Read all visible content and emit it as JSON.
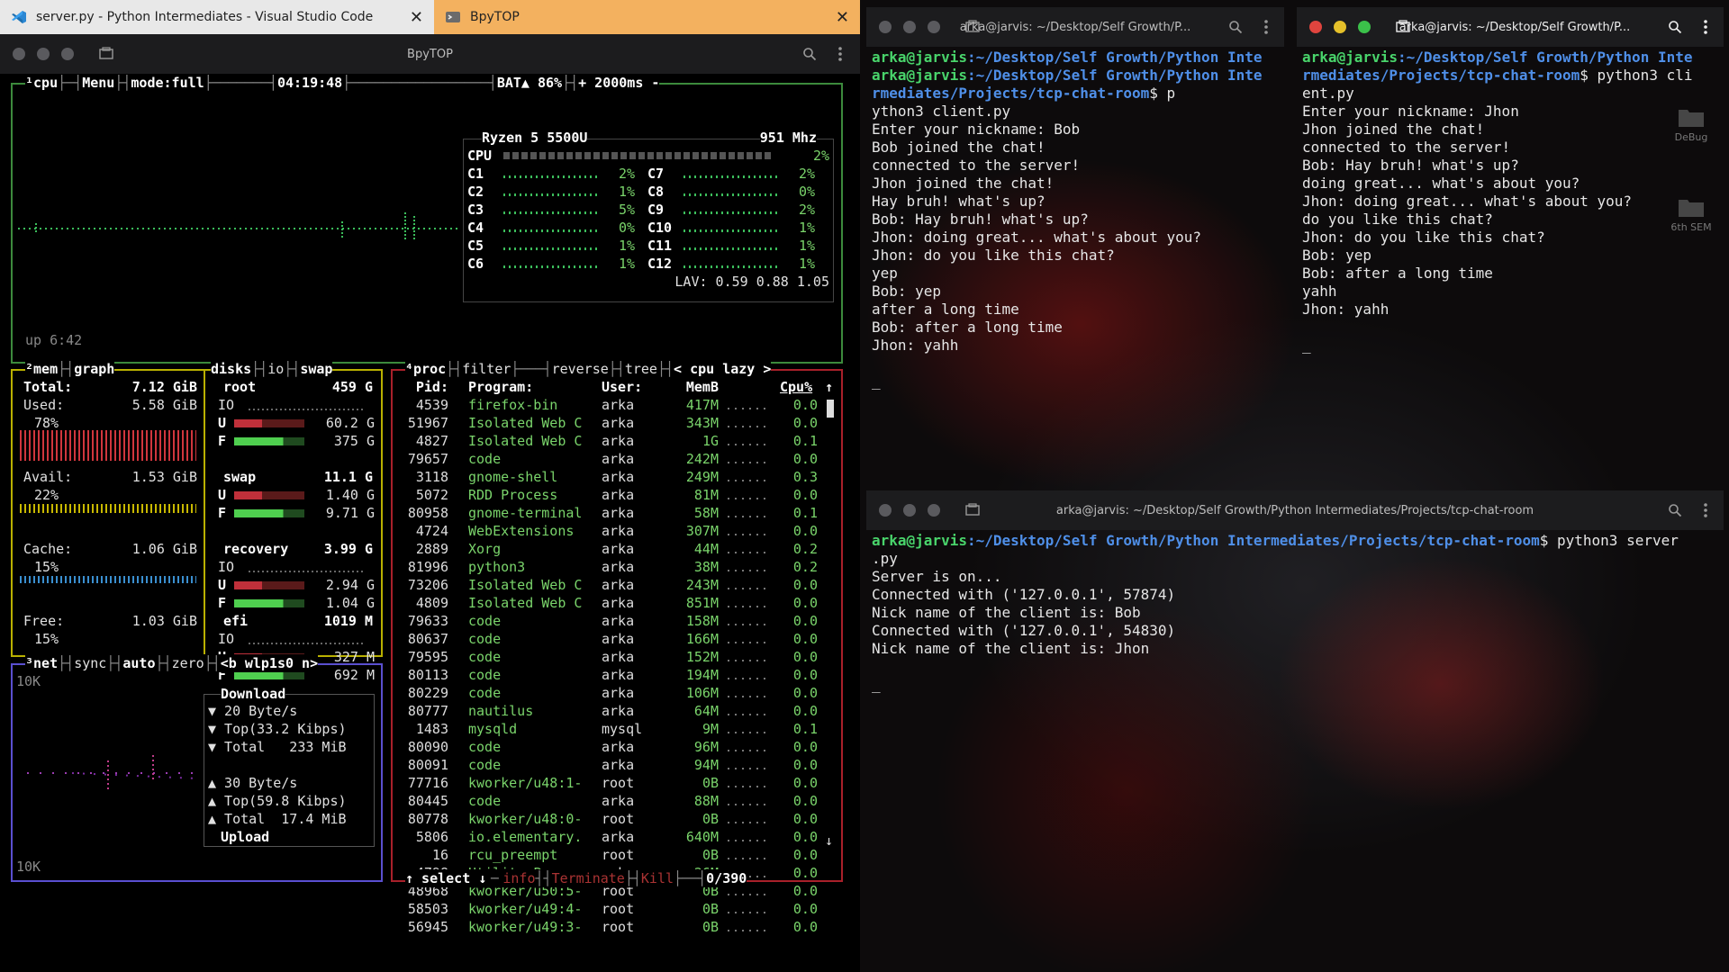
{
  "tabs": [
    {
      "label": "server.py - Python Intermediates - Visual Studio Code",
      "close": "✕"
    },
    {
      "label": "BpyTOP",
      "close": "✕"
    }
  ],
  "btop": {
    "window_title": "BpyTOP",
    "cpu_header": {
      "cpu": "¹cpu",
      "menu": "Menu",
      "mode": "mode:full",
      "clock": "04:19:48",
      "battery": "BAT▲ 86%",
      "update": "+ 2000ms -"
    },
    "cpu_model": "Ryzen 5 5500U",
    "cpu_freq": "951 Mhz",
    "cpu_total": {
      "label": "CPU",
      "pct": "2%"
    },
    "cores_left": [
      {
        "label": "C1",
        "pct": "2%"
      },
      {
        "label": "C2",
        "pct": "1%"
      },
      {
        "label": "C3",
        "pct": "5%"
      },
      {
        "label": "C4",
        "pct": "0%"
      },
      {
        "label": "C5",
        "pct": "1%"
      },
      {
        "label": "C6",
        "pct": "1%"
      }
    ],
    "cores_right": [
      {
        "label": "C7",
        "pct": "2%"
      },
      {
        "label": "C8",
        "pct": "0%"
      },
      {
        "label": "C9",
        "pct": "2%"
      },
      {
        "label": "C10",
        "pct": "1%"
      },
      {
        "label": "C11",
        "pct": "1%"
      },
      {
        "label": "C12",
        "pct": "1%"
      }
    ],
    "lav": "LAV: 0.59 0.88 1.05",
    "uptime": "up 6:42",
    "mem": {
      "header": {
        "mem": "²mem",
        "graph": "graph"
      },
      "total_label": "Total:",
      "total": "7.12 GiB",
      "used_label": "Used:",
      "used": "5.58 GiB",
      "used_pct": "78%",
      "avail_label": "Avail:",
      "avail": "1.53 GiB",
      "avail_pct": "22%",
      "cache_label": "Cache:",
      "cache": "1.06 GiB",
      "cache_pct": "15%",
      "free_label": "Free:",
      "free": "1.03 GiB",
      "free_pct": "15%"
    },
    "disks": {
      "header": {
        "disks": "disks",
        "io": "io",
        "swap": "swap"
      },
      "items": [
        {
          "name": "root",
          "size": "459 G",
          "io": "IO",
          "u": "60.2 G",
          "f": "375 G"
        },
        {
          "name": "swap",
          "size": "11.1 G",
          "u": "1.40 G",
          "f": "9.71 G"
        },
        {
          "name": "recovery",
          "size": "3.99 G",
          "io": "IO",
          "u": "2.94 G",
          "f": "1.04 G"
        },
        {
          "name": "efi",
          "size": "1019 M",
          "io": "IO",
          "u": "327 M",
          "f": "692 M"
        }
      ]
    },
    "net": {
      "header": {
        "net": "³net",
        "sync": "sync",
        "auto": "auto",
        "zero": "zero",
        "iface": "<b wlp1s0 n>"
      },
      "scale_top": "10K",
      "scale_bottom": "10K",
      "download_title": "Download",
      "down_rate": "▼ 20 Byte/s",
      "down_top": "▼ Top(33.2 Kibps)",
      "down_total": "▼ Total   233 MiB",
      "up_rate": "▲ 30 Byte/s",
      "up_top": "▲ Top(59.8 Kibps)",
      "up_total": "▲ Total  17.4 MiB",
      "upload_title": "Upload"
    },
    "proc": {
      "header": {
        "proc": "⁴proc",
        "filter": "filter",
        "reverse": "reverse",
        "tree": "tree",
        "sort": "< cpu lazy >"
      },
      "columns": {
        "pid": "Pid:",
        "program": "Program:",
        "user": "User:",
        "mem": "MemB",
        "cpu": "Cpu%"
      },
      "rows": [
        {
          "pid": "4539",
          "program": "firefox-bin",
          "user": "arka",
          "mem": "417M",
          "cpu": "0.0"
        },
        {
          "pid": "51967",
          "program": "Isolated Web C",
          "user": "arka",
          "mem": "343M",
          "cpu": "0.0"
        },
        {
          "pid": "4827",
          "program": "Isolated Web C",
          "user": "arka",
          "mem": "1G",
          "cpu": "0.1"
        },
        {
          "pid": "79657",
          "program": "code",
          "user": "arka",
          "mem": "242M",
          "cpu": "0.0"
        },
        {
          "pid": "3118",
          "program": "gnome-shell",
          "user": "arka",
          "mem": "249M",
          "cpu": "0.3"
        },
        {
          "pid": "5072",
          "program": "RDD Process",
          "user": "arka",
          "mem": "81M",
          "cpu": "0.0"
        },
        {
          "pid": "80958",
          "program": "gnome-terminal",
          "user": "arka",
          "mem": "58M",
          "cpu": "0.1"
        },
        {
          "pid": "4724",
          "program": "WebExtensions",
          "user": "arka",
          "mem": "307M",
          "cpu": "0.0"
        },
        {
          "pid": "2889",
          "program": "Xorg",
          "user": "arka",
          "mem": "44M",
          "cpu": "0.2"
        },
        {
          "pid": "81996",
          "program": "python3",
          "user": "arka",
          "mem": "38M",
          "cpu": "0.2"
        },
        {
          "pid": "73206",
          "program": "Isolated Web C",
          "user": "arka",
          "mem": "243M",
          "cpu": "0.0"
        },
        {
          "pid": "4809",
          "program": "Isolated Web C",
          "user": "arka",
          "mem": "851M",
          "cpu": "0.0"
        },
        {
          "pid": "79633",
          "program": "code",
          "user": "arka",
          "mem": "158M",
          "cpu": "0.0"
        },
        {
          "pid": "80637",
          "program": "code",
          "user": "arka",
          "mem": "166M",
          "cpu": "0.0"
        },
        {
          "pid": "79595",
          "program": "code",
          "user": "arka",
          "mem": "152M",
          "cpu": "0.0"
        },
        {
          "pid": "80113",
          "program": "code",
          "user": "arka",
          "mem": "194M",
          "cpu": "0.0"
        },
        {
          "pid": "80229",
          "program": "code",
          "user": "arka",
          "mem": "106M",
          "cpu": "0.0"
        },
        {
          "pid": "80777",
          "program": "nautilus",
          "user": "arka",
          "mem": "64M",
          "cpu": "0.0"
        },
        {
          "pid": "1483",
          "program": "mysqld",
          "user": "mysql",
          "mem": "9M",
          "cpu": "0.1"
        },
        {
          "pid": "80090",
          "program": "code",
          "user": "arka",
          "mem": "96M",
          "cpu": "0.0"
        },
        {
          "pid": "80091",
          "program": "code",
          "user": "arka",
          "mem": "94M",
          "cpu": "0.0"
        },
        {
          "pid": "77716",
          "program": "kworker/u48:1-",
          "user": "root",
          "mem": "0B",
          "cpu": "0.0"
        },
        {
          "pid": "80445",
          "program": "code",
          "user": "arka",
          "mem": "88M",
          "cpu": "0.0"
        },
        {
          "pid": "80778",
          "program": "kworker/u48:0-",
          "user": "root",
          "mem": "0B",
          "cpu": "0.0"
        },
        {
          "pid": "5806",
          "program": "io.elementary.",
          "user": "arka",
          "mem": "640M",
          "cpu": "0.0"
        },
        {
          "pid": "16",
          "program": "rcu_preempt",
          "user": "root",
          "mem": "0B",
          "cpu": "0.0"
        },
        {
          "pid": "4798",
          "program": "Utility Proces",
          "user": "arka",
          "mem": "26M",
          "cpu": "0.0"
        },
        {
          "pid": "48968",
          "program": "kworker/u50:5-",
          "user": "root",
          "mem": "0B",
          "cpu": "0.0"
        },
        {
          "pid": "58503",
          "program": "kworker/u49:4-",
          "user": "root",
          "mem": "0B",
          "cpu": "0.0"
        },
        {
          "pid": "56945",
          "program": "kworker/u49:3-",
          "user": "root",
          "mem": "0B",
          "cpu": "0.0"
        }
      ],
      "footer": {
        "select": "↑ select ↓",
        "info": "info",
        "terminate": "Terminate",
        "kill": "Kill",
        "count": "0/390"
      }
    }
  },
  "term_client1": {
    "title": "arka@jarvis: ~/Desktop/Self Growth/P...",
    "lines": [
      {
        "user": "arka@jarvis",
        "path": ":~/Desktop/Self Growth/Python Inte",
        "rest": ""
      },
      {
        "user": "arka@jarvis",
        "path": ":~/Desktop/Self Growth/Python Inte",
        "rest": ""
      },
      {
        "user": "",
        "path": "rmediates/Projects/tcp-chat-room",
        "rest": "$ p"
      },
      {
        "user": "",
        "path": "",
        "rest": "ython3 client.py"
      },
      {
        "user": "",
        "path": "",
        "rest": "Enter your nickname: Bob"
      },
      {
        "user": "",
        "path": "",
        "rest": "Bob joined the chat!"
      },
      {
        "user": "",
        "path": "",
        "rest": "connected to the server!"
      },
      {
        "user": "",
        "path": "",
        "rest": "Jhon joined the chat!"
      },
      {
        "user": "",
        "path": "",
        "rest": "Hay bruh! what's up?"
      },
      {
        "user": "",
        "path": "",
        "rest": "Bob: Hay bruh! what's up?"
      },
      {
        "user": "",
        "path": "",
        "rest": "Jhon: doing great... what's about you?"
      },
      {
        "user": "",
        "path": "",
        "rest": "Jhon: do you like this chat?"
      },
      {
        "user": "",
        "path": "",
        "rest": "yep"
      },
      {
        "user": "",
        "path": "",
        "rest": "Bob: yep"
      },
      {
        "user": "",
        "path": "",
        "rest": "after a long time"
      },
      {
        "user": "",
        "path": "",
        "rest": "Bob: after a long time"
      },
      {
        "user": "",
        "path": "",
        "rest": "Jhon: yahh"
      },
      {
        "user": "",
        "path": "",
        "rest": ""
      },
      {
        "user": "",
        "path": "",
        "rest": "_"
      }
    ]
  },
  "term_client2": {
    "title": "arka@jarvis: ~/Desktop/Self Growth/P...",
    "lines": [
      {
        "user": "arka@jarvis",
        "path": ":~/Desktop/Self Growth/Python Inte",
        "rest": ""
      },
      {
        "user": "",
        "path": "rmediates/Projects/tcp-chat-room",
        "rest": "$ python3 cli"
      },
      {
        "user": "",
        "path": "",
        "rest": "ent.py"
      },
      {
        "user": "",
        "path": "",
        "rest": "Enter your nickname: Jhon"
      },
      {
        "user": "",
        "path": "",
        "rest": "Jhon joined the chat!"
      },
      {
        "user": "",
        "path": "",
        "rest": "connected to the server!"
      },
      {
        "user": "",
        "path": "",
        "rest": "Bob: Hay bruh! what's up?"
      },
      {
        "user": "",
        "path": "",
        "rest": "doing great... what's about you?"
      },
      {
        "user": "",
        "path": "",
        "rest": "Jhon: doing great... what's about you?"
      },
      {
        "user": "",
        "path": "",
        "rest": "do you like this chat?"
      },
      {
        "user": "",
        "path": "",
        "rest": "Jhon: do you like this chat?"
      },
      {
        "user": "",
        "path": "",
        "rest": "Bob: yep"
      },
      {
        "user": "",
        "path": "",
        "rest": "Bob: after a long time"
      },
      {
        "user": "",
        "path": "",
        "rest": "yahh"
      },
      {
        "user": "",
        "path": "",
        "rest": "Jhon: yahh"
      },
      {
        "user": "",
        "path": "",
        "rest": ""
      },
      {
        "user": "",
        "path": "",
        "rest": "_"
      }
    ],
    "desktop_icons": [
      {
        "label": "DeBug"
      },
      {
        "label": "6th SEM"
      }
    ]
  },
  "term_server": {
    "title": "arka@jarvis: ~/Desktop/Self Growth/Python Intermediates/Projects/tcp-chat-room",
    "lines": [
      {
        "user": "arka@jarvis",
        "path": ":~/Desktop/Self Growth/Python Intermediates/Projects/tcp-chat-room",
        "rest": "$ python3 server"
      },
      {
        "user": "",
        "path": "",
        "rest": ".py"
      },
      {
        "user": "",
        "path": "",
        "rest": "Server is on..."
      },
      {
        "user": "",
        "path": "",
        "rest": "Connected with ('127.0.0.1', 57874)"
      },
      {
        "user": "",
        "path": "",
        "rest": "Nick name of the client is: Bob"
      },
      {
        "user": "",
        "path": "",
        "rest": "Connected with ('127.0.0.1', 54830)"
      },
      {
        "user": "",
        "path": "",
        "rest": "Nick name of the client is: Jhon"
      },
      {
        "user": "",
        "path": "",
        "rest": ""
      },
      {
        "user": "",
        "path": "",
        "rest": "_"
      }
    ]
  },
  "colors": {
    "accent_tab": "#f3b15f",
    "prompt_user": "#49d46b",
    "prompt_path": "#4f8fe8"
  }
}
